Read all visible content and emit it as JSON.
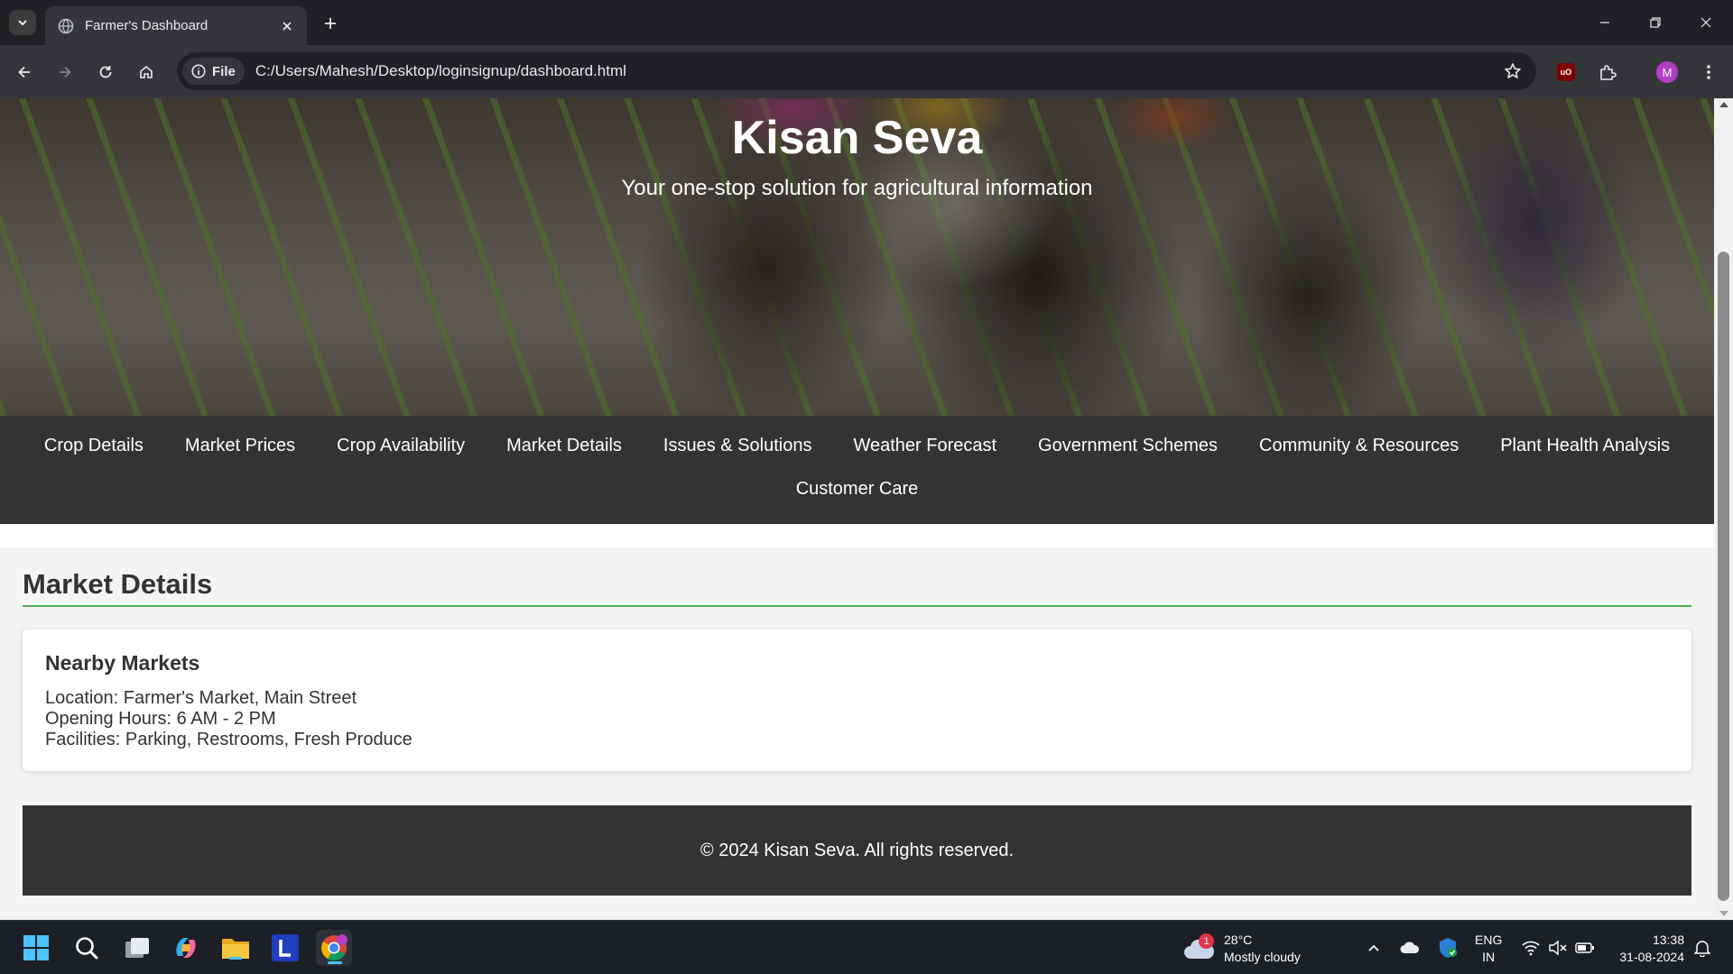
{
  "browser": {
    "tab_title": "Farmer's Dashboard",
    "file_chip_label": "File",
    "url": "C:/Users/Mahesh/Desktop/loginsignup/dashboard.html",
    "profile_initial": "M",
    "ublock_label": "uO"
  },
  "hero": {
    "title": "Kisan Seva",
    "subtitle": "Your one-stop solution for agricultural information"
  },
  "nav": {
    "items": [
      {
        "label": "Crop Details"
      },
      {
        "label": "Market Prices"
      },
      {
        "label": "Crop Availability"
      },
      {
        "label": "Market Details"
      },
      {
        "label": "Issues & Solutions"
      },
      {
        "label": "Weather Forecast"
      },
      {
        "label": "Government Schemes"
      },
      {
        "label": "Community & Resources"
      },
      {
        "label": "Plant Health Analysis"
      },
      {
        "label": "Customer Care"
      }
    ]
  },
  "section": {
    "title": "Market Details",
    "card": {
      "title": "Nearby Markets",
      "lines": [
        "Location: Farmer's Market, Main Street",
        "Opening Hours: 6 AM - 2 PM",
        "Facilities: Parking, Restrooms, Fresh Produce"
      ]
    }
  },
  "footer": {
    "text": "© 2024 Kisan Seva. All rights reserved."
  },
  "colors": {
    "nav_bg": "#333333",
    "accent_rule": "#4caf50",
    "content_bg": "#f4f4f4"
  },
  "taskbar": {
    "apps": [
      "windows-start-icon",
      "search-icon",
      "task-view-icon",
      "copilot-icon",
      "file-explorer-icon",
      "l-app-icon",
      "chrome-icon"
    ],
    "weather": {
      "temperature": "28°C",
      "condition": "Mostly cloudy",
      "badge": "1"
    },
    "language": {
      "line1": "ENG",
      "line2": "IN"
    },
    "clock": {
      "time": "13:38",
      "date": "31-08-2024"
    }
  }
}
